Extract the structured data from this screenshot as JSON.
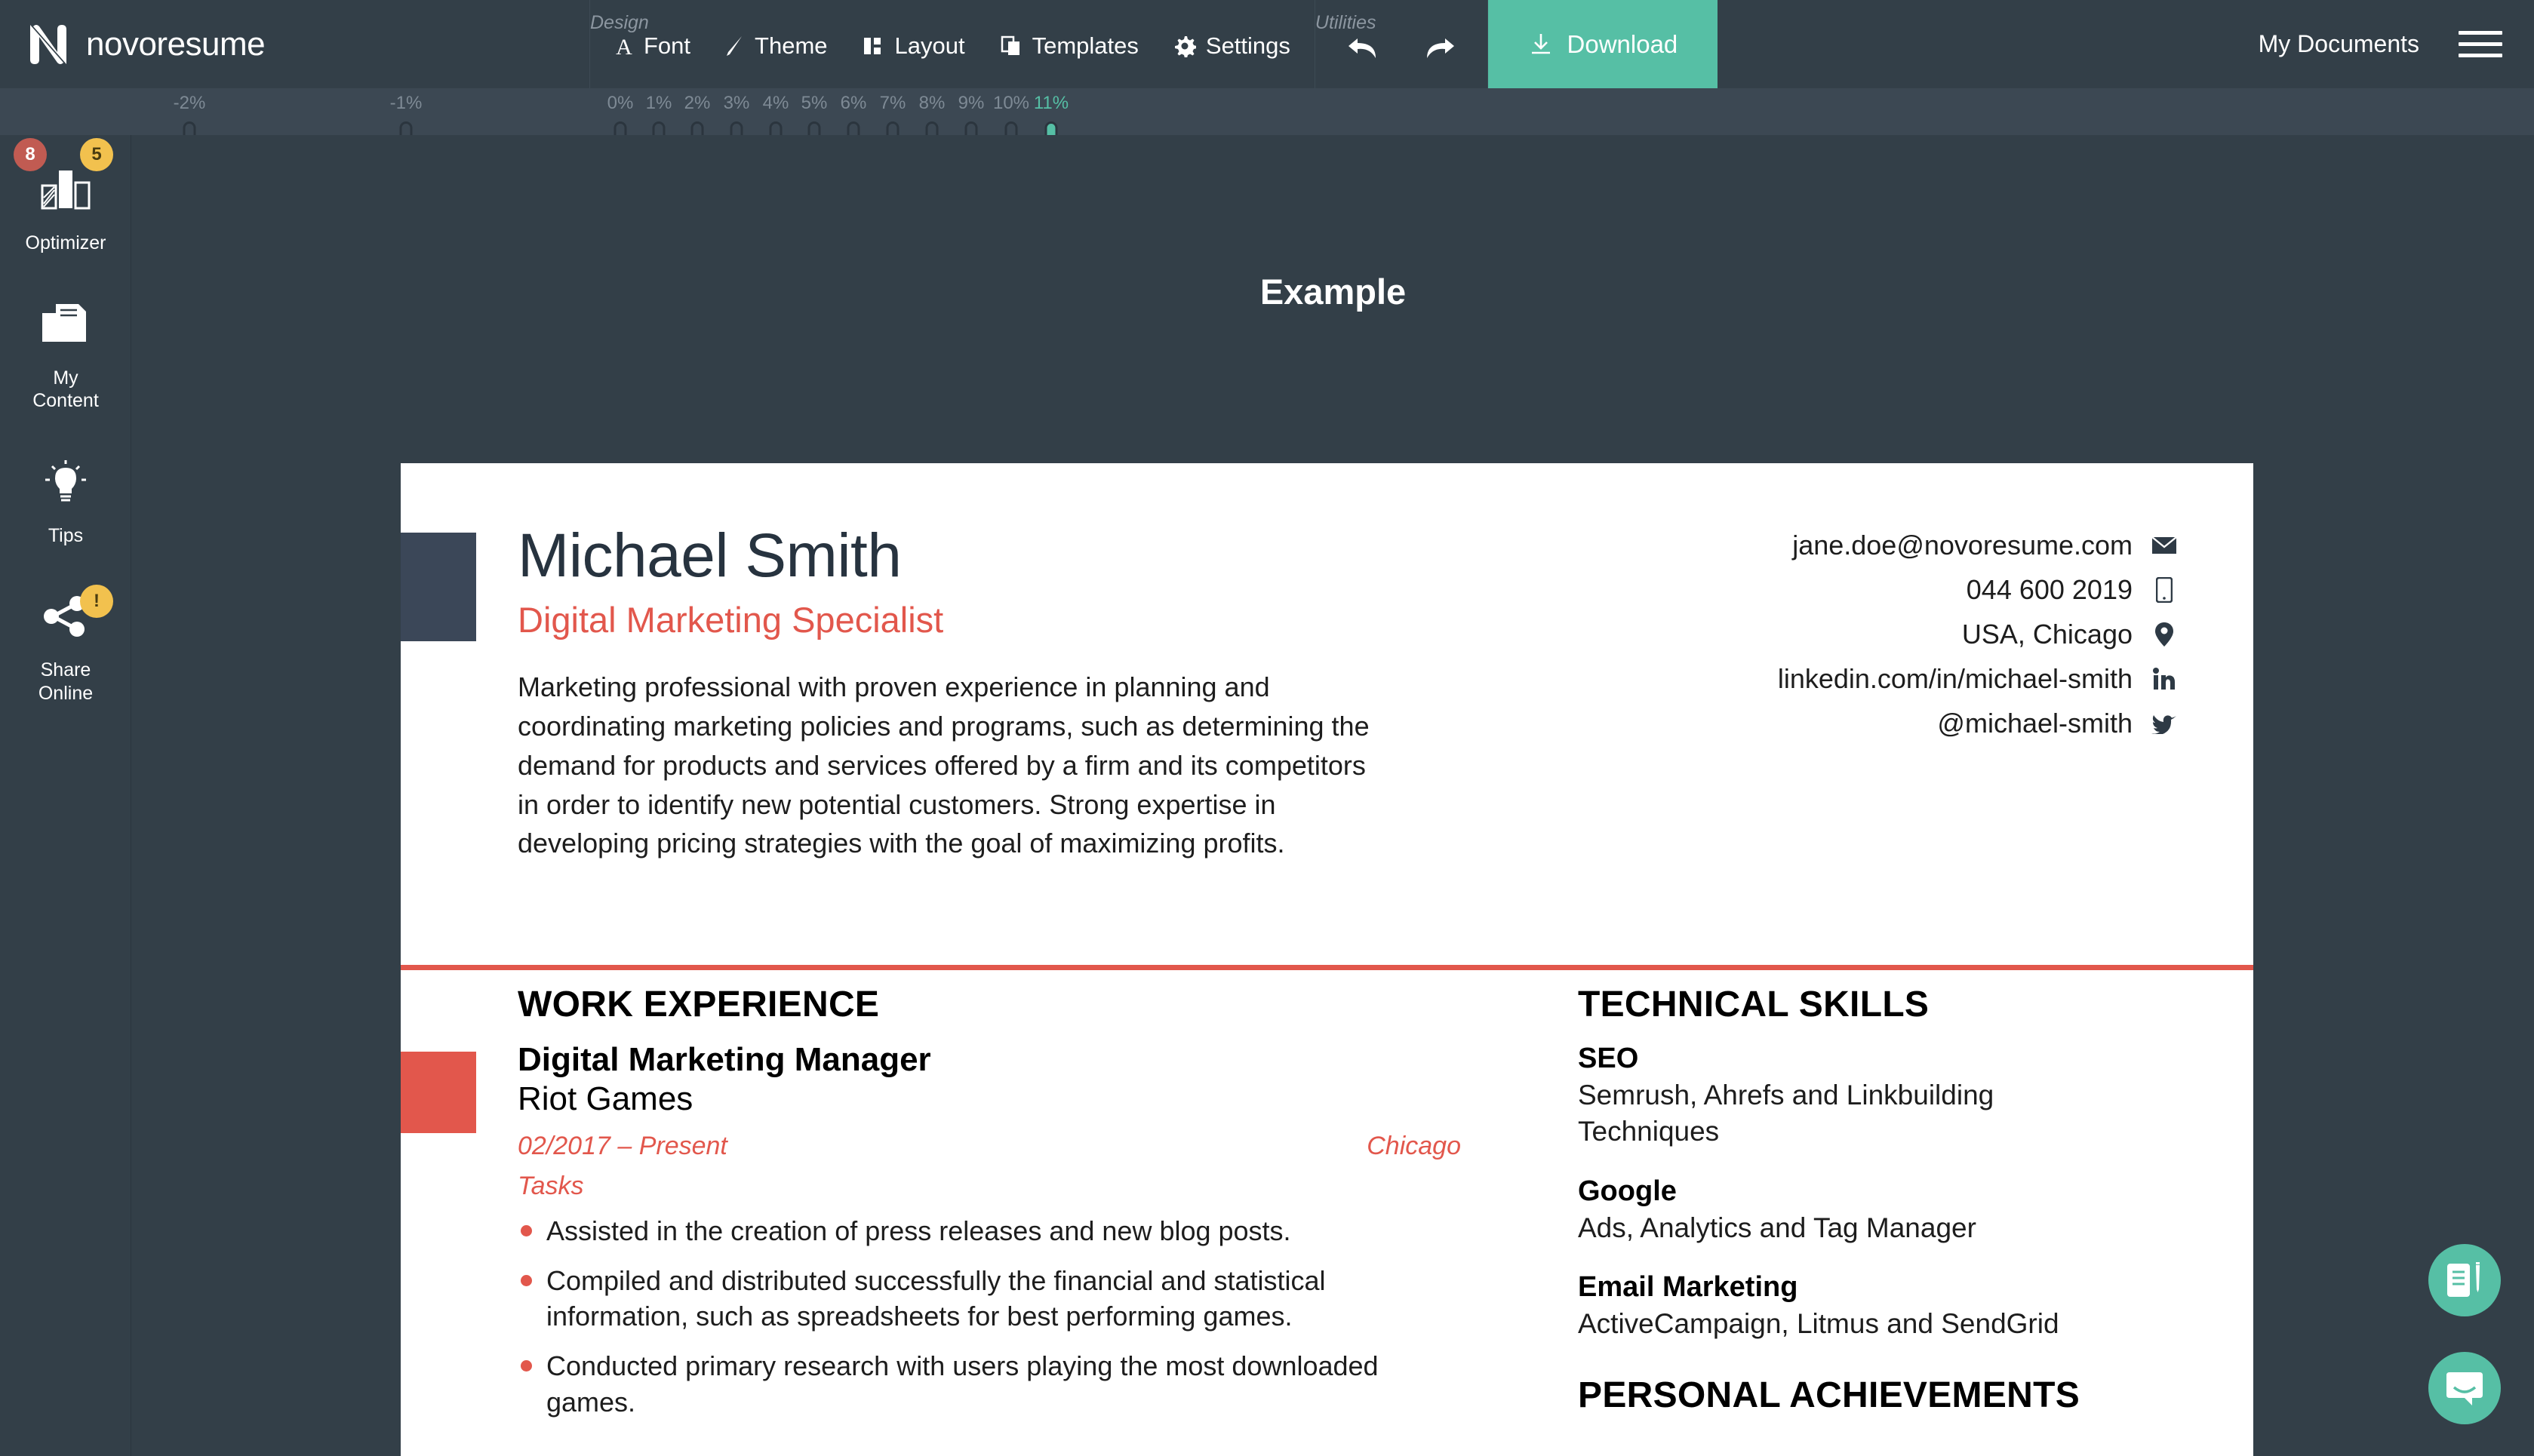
{
  "app": {
    "brand_name": "novoresume",
    "brand_logo_icon": "novoresume-n-logo"
  },
  "toolbar": {
    "design_label": "Design",
    "design_items": [
      {
        "label": "Font",
        "icon": "font-a-icon"
      },
      {
        "label": "Theme",
        "icon": "brush-icon"
      },
      {
        "label": "Layout",
        "icon": "layout-columns-icon"
      },
      {
        "label": "Templates",
        "icon": "templates-stack-icon"
      },
      {
        "label": "Settings",
        "icon": "gear-icon"
      }
    ],
    "utilities_label": "Utilities",
    "utility_items": [
      {
        "name": "undo",
        "icon": "undo-arrow-icon"
      },
      {
        "name": "redo",
        "icon": "redo-arrow-icon"
      }
    ],
    "download_label": "Download",
    "download_icon": "download-icon",
    "download_color": "#56bfa5",
    "my_documents_label": "My Documents",
    "menu_icon": "hamburger-menu-icon"
  },
  "ruler": {
    "active_value": "11%",
    "ticks": [
      {
        "label": "-2%",
        "pos": 251,
        "active": false
      },
      {
        "label": "-1%",
        "pos": 538,
        "active": false
      },
      {
        "label": "0%",
        "pos": 822,
        "active": false
      },
      {
        "label": "1%",
        "pos": 873,
        "active": false
      },
      {
        "label": "2%",
        "pos": 924,
        "active": false
      },
      {
        "label": "3%",
        "pos": 976,
        "active": false
      },
      {
        "label": "4%",
        "pos": 1028,
        "active": false
      },
      {
        "label": "5%",
        "pos": 1079,
        "active": false
      },
      {
        "label": "6%",
        "pos": 1131,
        "active": false
      },
      {
        "label": "7%",
        "pos": 1183,
        "active": false
      },
      {
        "label": "8%",
        "pos": 1235,
        "active": false
      },
      {
        "label": "9%",
        "pos": 1287,
        "active": false
      },
      {
        "label": "10%",
        "pos": 1340,
        "active": false
      },
      {
        "label": "11%",
        "pos": 1393,
        "active": true
      }
    ]
  },
  "sidebar": {
    "items": [
      {
        "label": "Optimizer",
        "icon": "bar-chart-icon",
        "badges": [
          {
            "text": "8",
            "color": "#c15b52"
          },
          {
            "text": "5",
            "color": "#f2c14e"
          }
        ]
      },
      {
        "label": "My\nContent",
        "icon": "folder-document-icon",
        "badges": []
      },
      {
        "label": "Tips",
        "icon": "lightbulb-icon",
        "badges": []
      },
      {
        "label": "Share\nOnline",
        "icon": "share-nodes-icon",
        "badges": [
          {
            "text": "!",
            "color": "#f2c14e"
          }
        ]
      }
    ]
  },
  "canvas": {
    "document_title": "Example"
  },
  "resume": {
    "name": "Michael Smith",
    "job_title": "Digital Marketing Specialist",
    "summary": "Marketing professional with proven experience in planning and coordinating marketing policies and programs, such as determining the demand for products and services offered by a firm and its competitors in order to identify new potential customers. Strong expertise in developing pricing strategies with the goal of maximizing profits.",
    "accent_color": "#e2574c",
    "contacts": [
      {
        "text": "jane.doe@novoresume.com",
        "icon": "email-envelope-icon"
      },
      {
        "text": "044 600 2019",
        "icon": "mobile-phone-icon"
      },
      {
        "text": "USA, Chicago",
        "icon": "location-pin-icon"
      },
      {
        "text": "linkedin.com/in/michael-smith",
        "icon": "linkedin-icon"
      },
      {
        "text": "@michael-smith",
        "icon": "twitter-bird-icon"
      }
    ],
    "work_experience": {
      "heading": "WORK EXPERIENCE",
      "position": "Digital Marketing Manager",
      "company": "Riot Games",
      "dates": "02/2017 – Present",
      "location": "Chicago",
      "tasks_label": "Tasks",
      "bullets": [
        "Assisted in the creation of press releases and new blog posts.",
        "Compiled and distributed successfully the financial and statistical information, such as spreadsheets for best performing games.",
        "Conducted primary research with users playing the most downloaded games."
      ]
    },
    "technical_skills": {
      "heading": "TECHNICAL SKILLS",
      "groups": [
        {
          "name": "SEO",
          "description": "Semrush, Ahrefs and Linkbuilding Techniques"
        },
        {
          "name": "Google",
          "description": "Ads, Analytics and Tag Manager"
        },
        {
          "name": "Email Marketing",
          "description": "ActiveCampaign, Litmus and SendGrid"
        }
      ]
    },
    "personal_achievements": {
      "heading": "PERSONAL ACHIEVEMENTS"
    }
  },
  "floating_buttons": [
    {
      "name": "edit-document",
      "icon": "document-pencil-icon",
      "color": "#56bfa5"
    },
    {
      "name": "chat-support",
      "icon": "chat-bubble-icon",
      "color": "#56bfa5"
    }
  ]
}
